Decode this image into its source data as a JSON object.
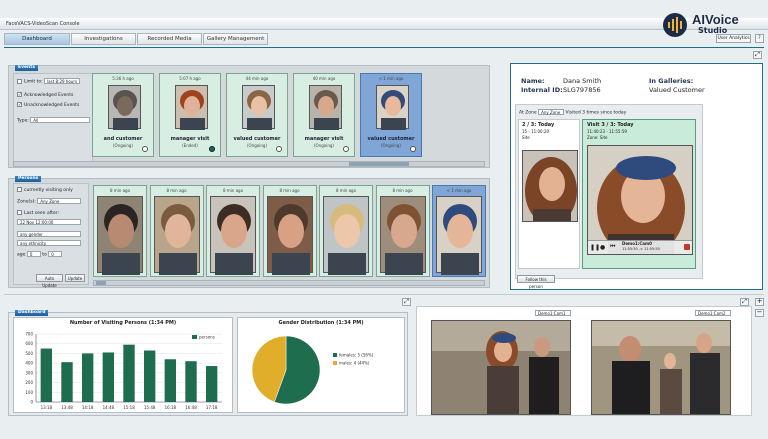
{
  "window": {
    "title": "FaceVACS-VideoScan Console"
  },
  "watermark": {
    "brand": "AIVoice",
    "sub": "Studio"
  },
  "tabs": [
    {
      "label": "Dashboard",
      "active": true
    },
    {
      "label": "Investigations",
      "active": false
    },
    {
      "label": "Recorded Media",
      "active": false
    },
    {
      "label": "Gallery Management",
      "active": false
    }
  ],
  "top_buttons": {
    "user_analytics": "User Analytics",
    "help": "?"
  },
  "events": {
    "header": "Events",
    "filters": {
      "limit_to": "Limit to:",
      "limit_value": "last 8:29 hours",
      "acknowledged": "Acknowledged Events",
      "unacknowledged": "Unacknowledged Events",
      "type_label": "Type:",
      "type_value": "All"
    },
    "cards": [
      {
        "time": "5:36 h ago",
        "label": "and customer",
        "sub": "(Ongoing)",
        "selected": false,
        "dot_filled": false,
        "face": "#7a6a5c",
        "hair": "#5b5350",
        "bg": "#b7b7b5"
      },
      {
        "time": "5:07 h ago",
        "label": "manager visit",
        "sub": "(Ended)",
        "selected": false,
        "dot_filled": true,
        "face": "#e0b29a",
        "hair": "#a0421f",
        "bg": "#cdbfae"
      },
      {
        "time": "44 min ago",
        "label": "valued customer",
        "sub": "(Ongoing)",
        "selected": false,
        "dot_filled": false,
        "face": "#e8c1a6",
        "hair": "#8a6744",
        "bg": "#c7cbcc"
      },
      {
        "time": "40 min ago",
        "label": "manager visit",
        "sub": "(Ongoing)",
        "selected": false,
        "dot_filled": false,
        "face": "#d8a88c",
        "hair": "#6a5a4c",
        "bg": "#b9b4ab"
      },
      {
        "time": "< 1 min ago",
        "label": "valued customer",
        "sub": "(Ongoing)",
        "selected": true,
        "dot_filled": false,
        "face": "#e8b99c",
        "hair": "#364a78",
        "bg": "#d9d3c8"
      }
    ]
  },
  "persons": {
    "header": "Persons",
    "filters": {
      "currently_visiting": "currently visiting only",
      "zone_label": "Zone(s):",
      "zone_value": "Any Zone",
      "last_seen": "Last seen after:",
      "last_seen_value": "22 Nov 12:00:00",
      "gender": "any gender",
      "ethnicity": "any ethnicity",
      "age_label": "age",
      "age_from": "0",
      "age_to_label": "to",
      "age_to": "0",
      "auto_update": "Auto Update",
      "update": "Update"
    },
    "cards": [
      {
        "time": "8 min ago",
        "face": "#b98a72",
        "hair": "#2a2422",
        "bg": "#8f8474",
        "selected": false
      },
      {
        "time": "8 min ago",
        "face": "#e1b59a",
        "hair": "#7b5b3e",
        "bg": "#b8a58b",
        "selected": false
      },
      {
        "time": "8 min ago",
        "face": "#d9a68a",
        "hair": "#3d2c24",
        "bg": "#c8c4bc",
        "selected": false
      },
      {
        "time": "8 min ago",
        "face": "#d8a184",
        "hair": "#4d3a2d",
        "bg": "#7e5c47",
        "selected": false
      },
      {
        "time": "8 min ago",
        "face": "#ecc7aa",
        "hair": "#d6bb7c",
        "bg": "#bfc5c7",
        "selected": false
      },
      {
        "time": "8 min ago",
        "face": "#d8a88e",
        "hair": "#7d5334",
        "bg": "#9f8d7c",
        "selected": false
      },
      {
        "time": "< 1 min ago",
        "face": "#e5b597",
        "hair": "#2f4b7d",
        "bg": "#d7d1c6",
        "selected": true
      }
    ]
  },
  "person_info": {
    "name_label": "Name:",
    "name": "Dana Smith",
    "id_label": "Internal ID:",
    "id": "SLG797856",
    "galleries_label": "In Galleries:",
    "galleries": "Valued Customer",
    "zone_label": "At Zone",
    "zone_value": "Any Zone",
    "visited_text": "Visited 3 times since today",
    "visit2_title": "2 / 3: Today",
    "visit2_time": "15 - 11:00:20",
    "visit2_zone": "Site",
    "visit3_title": "Visit 3 / 3: Today",
    "visit3_time": "11:40:23 - 11:55:59",
    "visit3_zone": "Zone: Site",
    "cam_label": "Demo1:Cam0",
    "cam_time": "11:55:30 -> 11:55:50",
    "follow_button": "Follow this person"
  },
  "dashboard": {
    "header": "Dashboard",
    "bar_title": "Number of Visiting Persons (1:34 PM)",
    "pie_title": "Gender Distribution (1:34 PM)"
  },
  "cameras": [
    {
      "select": "Demo1:Cam1"
    },
    {
      "select": "Demo1:Cam2"
    }
  ],
  "chart_data": [
    {
      "type": "bar",
      "title": "Number of Visiting Persons (1:34 PM)",
      "categories": [
        "13:18",
        "13:48",
        "14:18",
        "14:48",
        "15:18",
        "15:48",
        "16:18",
        "16:48",
        "17:18"
      ],
      "series": [
        {
          "name": "persons",
          "values": [
            550,
            410,
            500,
            510,
            590,
            530,
            440,
            420,
            370
          ]
        }
      ],
      "ylim": [
        0,
        700
      ],
      "yticks": [
        0,
        100,
        200,
        300,
        400,
        500,
        600,
        700
      ],
      "color": "#1e6d4e",
      "legend": "top-right"
    },
    {
      "type": "pie",
      "title": "Gender Distribution (1:34 PM)",
      "slices": [
        {
          "label": "females",
          "value": 5,
          "display": "females: 5 (56%)",
          "color": "#1e6d4e"
        },
        {
          "label": "males",
          "value": 4,
          "display": "males: 4 (44%)",
          "color": "#e1ae2c"
        }
      ],
      "legend": "right"
    }
  ]
}
